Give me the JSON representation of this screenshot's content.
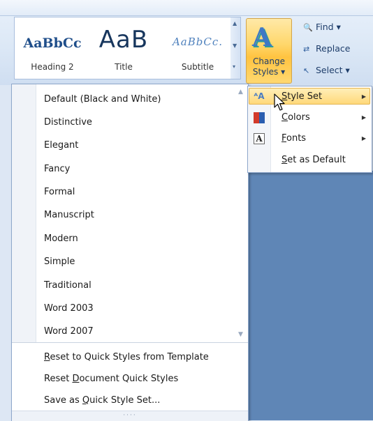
{
  "ribbon": {
    "quick_styles": [
      {
        "sample": "AaBbCc",
        "name": "Heading 2"
      },
      {
        "sample": "AaB",
        "name": "Title"
      },
      {
        "sample": "AaBbCc.",
        "name": "Subtitle"
      }
    ],
    "change_styles": {
      "line1": "Change",
      "line2": "Styles ▾"
    },
    "editing": {
      "find": "Find ▾",
      "replace": "Replace",
      "select": "Select ▾"
    }
  },
  "style_set_menu": {
    "items": [
      "Default (Black and White)",
      "Distinctive",
      "Elegant",
      "Fancy",
      "Formal",
      "Manuscript",
      "Modern",
      "Simple",
      "Traditional",
      "Word 2003",
      "Word 2007"
    ],
    "actions": [
      {
        "pre": "",
        "u": "R",
        "post": "eset to Quick Styles from Template"
      },
      {
        "pre": "Reset ",
        "u": "D",
        "post": "ocument Quick Styles"
      },
      {
        "pre": "Save as ",
        "u": "Q",
        "post": "uick Style Set..."
      }
    ]
  },
  "change_styles_menu": {
    "items": [
      {
        "u": "S",
        "post": "tyle Set",
        "icon": "style-set-icon",
        "has_submenu": true
      },
      {
        "u": "C",
        "post": "olors",
        "icon": "colors-icon",
        "has_submenu": true
      },
      {
        "u": "F",
        "post": "onts",
        "icon": "fonts-icon",
        "has_submenu": true
      },
      {
        "u": "S",
        "post": "et as Default",
        "icon": "",
        "has_submenu": false
      }
    ]
  }
}
